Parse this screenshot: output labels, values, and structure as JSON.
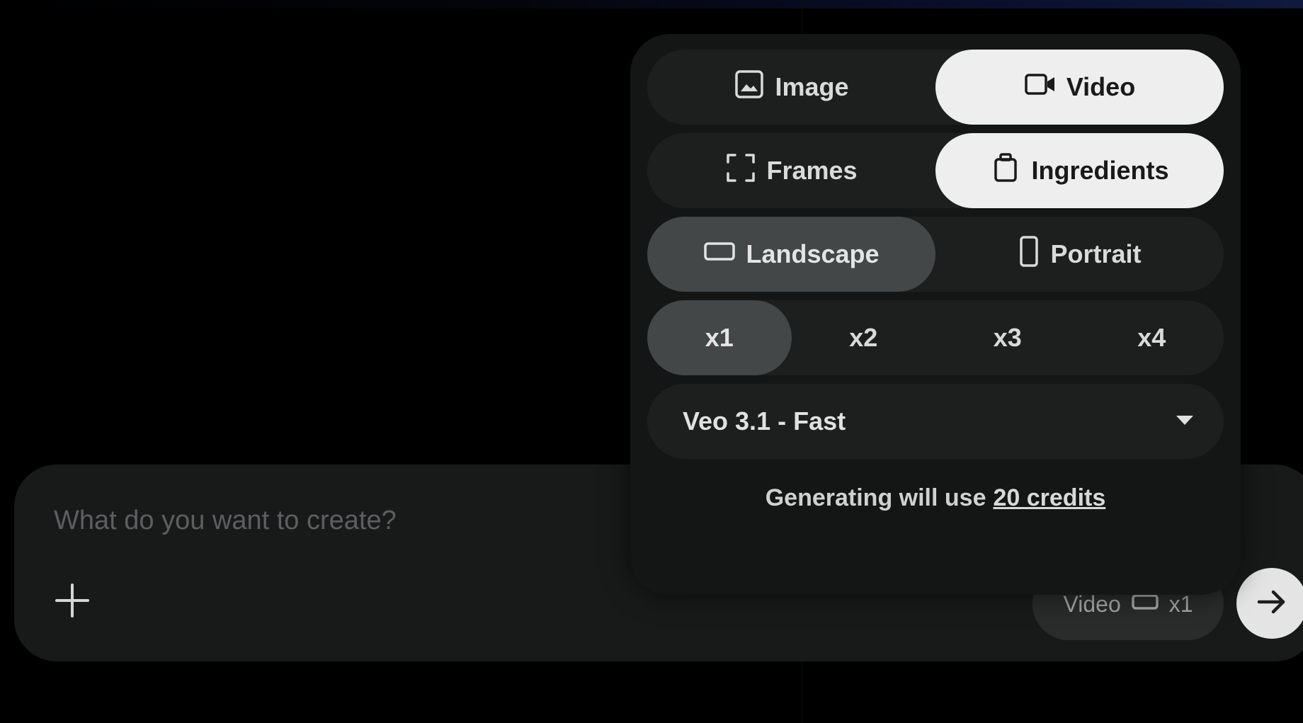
{
  "prompt": {
    "placeholder": "What do you want to create?"
  },
  "settings": {
    "output_type": {
      "options": [
        {
          "label": "Image",
          "icon": "image-icon"
        },
        {
          "label": "Video",
          "icon": "video-camera-icon"
        }
      ],
      "selected": "Video"
    },
    "video_source": {
      "options": [
        {
          "label": "Frames",
          "icon": "frames-icon"
        },
        {
          "label": "Ingredients",
          "icon": "ingredients-icon"
        }
      ],
      "selected": "Ingredients"
    },
    "orientation": {
      "options": [
        {
          "label": "Landscape",
          "icon": "landscape-icon"
        },
        {
          "label": "Portrait",
          "icon": "portrait-icon"
        }
      ],
      "selected": "Landscape"
    },
    "count": {
      "options": [
        "x1",
        "x2",
        "x3",
        "x4"
      ],
      "selected": "x1"
    },
    "model": {
      "selected": "Veo 3.1 - Fast"
    },
    "credits": {
      "text": "Generating will use",
      "link": "20 credits"
    }
  },
  "summary_chip": {
    "type": "Video",
    "count": "x1"
  },
  "colors": {
    "background": "#000000",
    "panel": "#141616",
    "segment": "#1d1f1f",
    "selected_light": "#eeeeee",
    "selected_dark": "#444747",
    "prompt_bar": "#181a1a"
  }
}
